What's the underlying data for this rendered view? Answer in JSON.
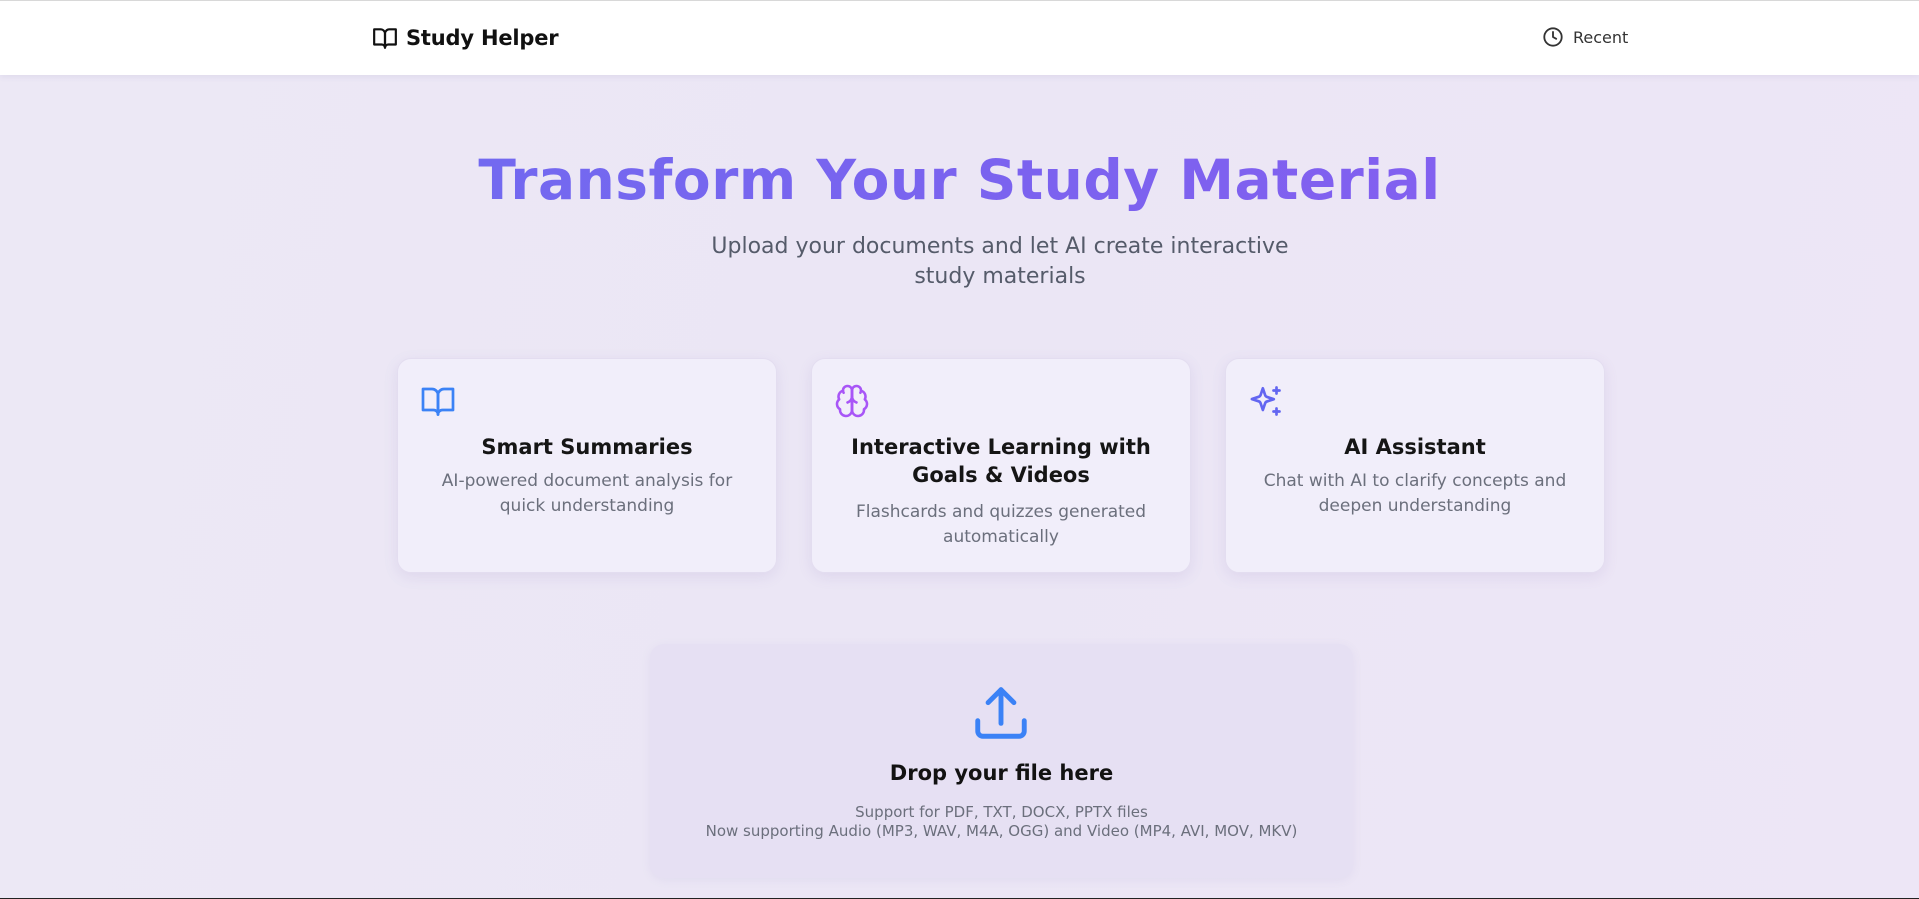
{
  "header": {
    "brand_icon": "book-open-icon",
    "brand_name": "Study Helper",
    "recent_icon": "clock-icon",
    "recent_label": "Recent"
  },
  "hero": {
    "title": "Transform Your Study Material",
    "subtitle": "Upload your documents and let AI create interactive study materials"
  },
  "features": [
    {
      "icon": "book-open-icon",
      "title": "Smart Summaries",
      "description": "AI-powered document analysis for quick understanding"
    },
    {
      "icon": "brain-icon",
      "title": "Interactive Learning with Goals & Videos",
      "description": "Flashcards and quizzes generated automatically"
    },
    {
      "icon": "sparkles-icon",
      "title": "AI Assistant",
      "description": "Chat with AI to clarify concepts and deepen understanding"
    }
  ],
  "upload": {
    "icon": "upload-icon",
    "title": "Drop your file here",
    "formats": "Support for PDF, TXT, DOCX, PPTX files",
    "media": "Now supporting Audio (MP3, WAV, M4A, OGG) and Video (MP4, AVI, MOV, MKV)"
  },
  "colors": {
    "accent_blue": "#3b82f6",
    "accent_purple": "#a855f7",
    "accent_indigo": "#6366f1",
    "title_gradient_start": "#6b6ff0",
    "title_gradient_end": "#8a5cf0"
  }
}
